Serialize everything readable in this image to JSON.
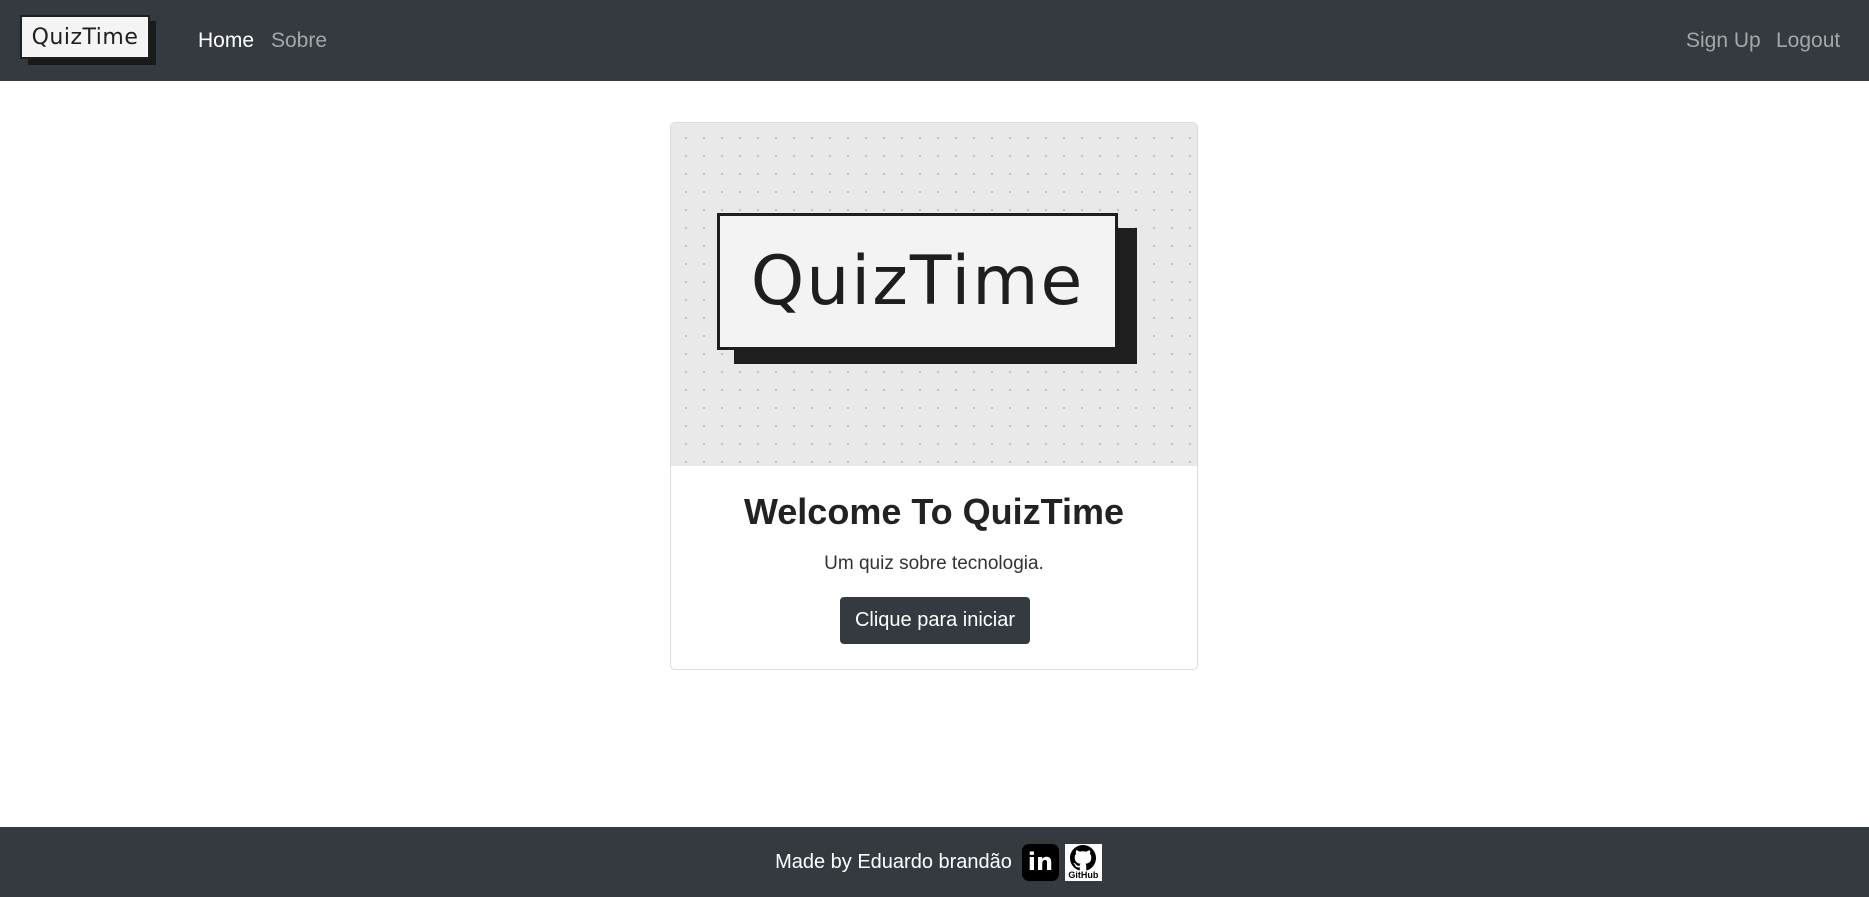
{
  "navbar": {
    "brand": "QuizTime",
    "links": [
      {
        "label": "Home",
        "active": true
      },
      {
        "label": "Sobre",
        "active": false
      }
    ],
    "right_links": [
      {
        "label": "Sign Up"
      },
      {
        "label": "Logout"
      }
    ]
  },
  "card": {
    "image_logo_text": "QuizTime",
    "title": "Welcome To QuizTime",
    "text": "Um quiz sobre tecnologia.",
    "button_label": "Clique para iniciar"
  },
  "footer": {
    "text": "Made by Eduardo brandão",
    "linkedin_icon": "linkedin-icon",
    "github_icon": "github-icon",
    "github_label": "GitHub"
  },
  "colors": {
    "navbar_bg": "#343a40",
    "button_bg": "#343a40",
    "footer_bg": "#343a40"
  }
}
